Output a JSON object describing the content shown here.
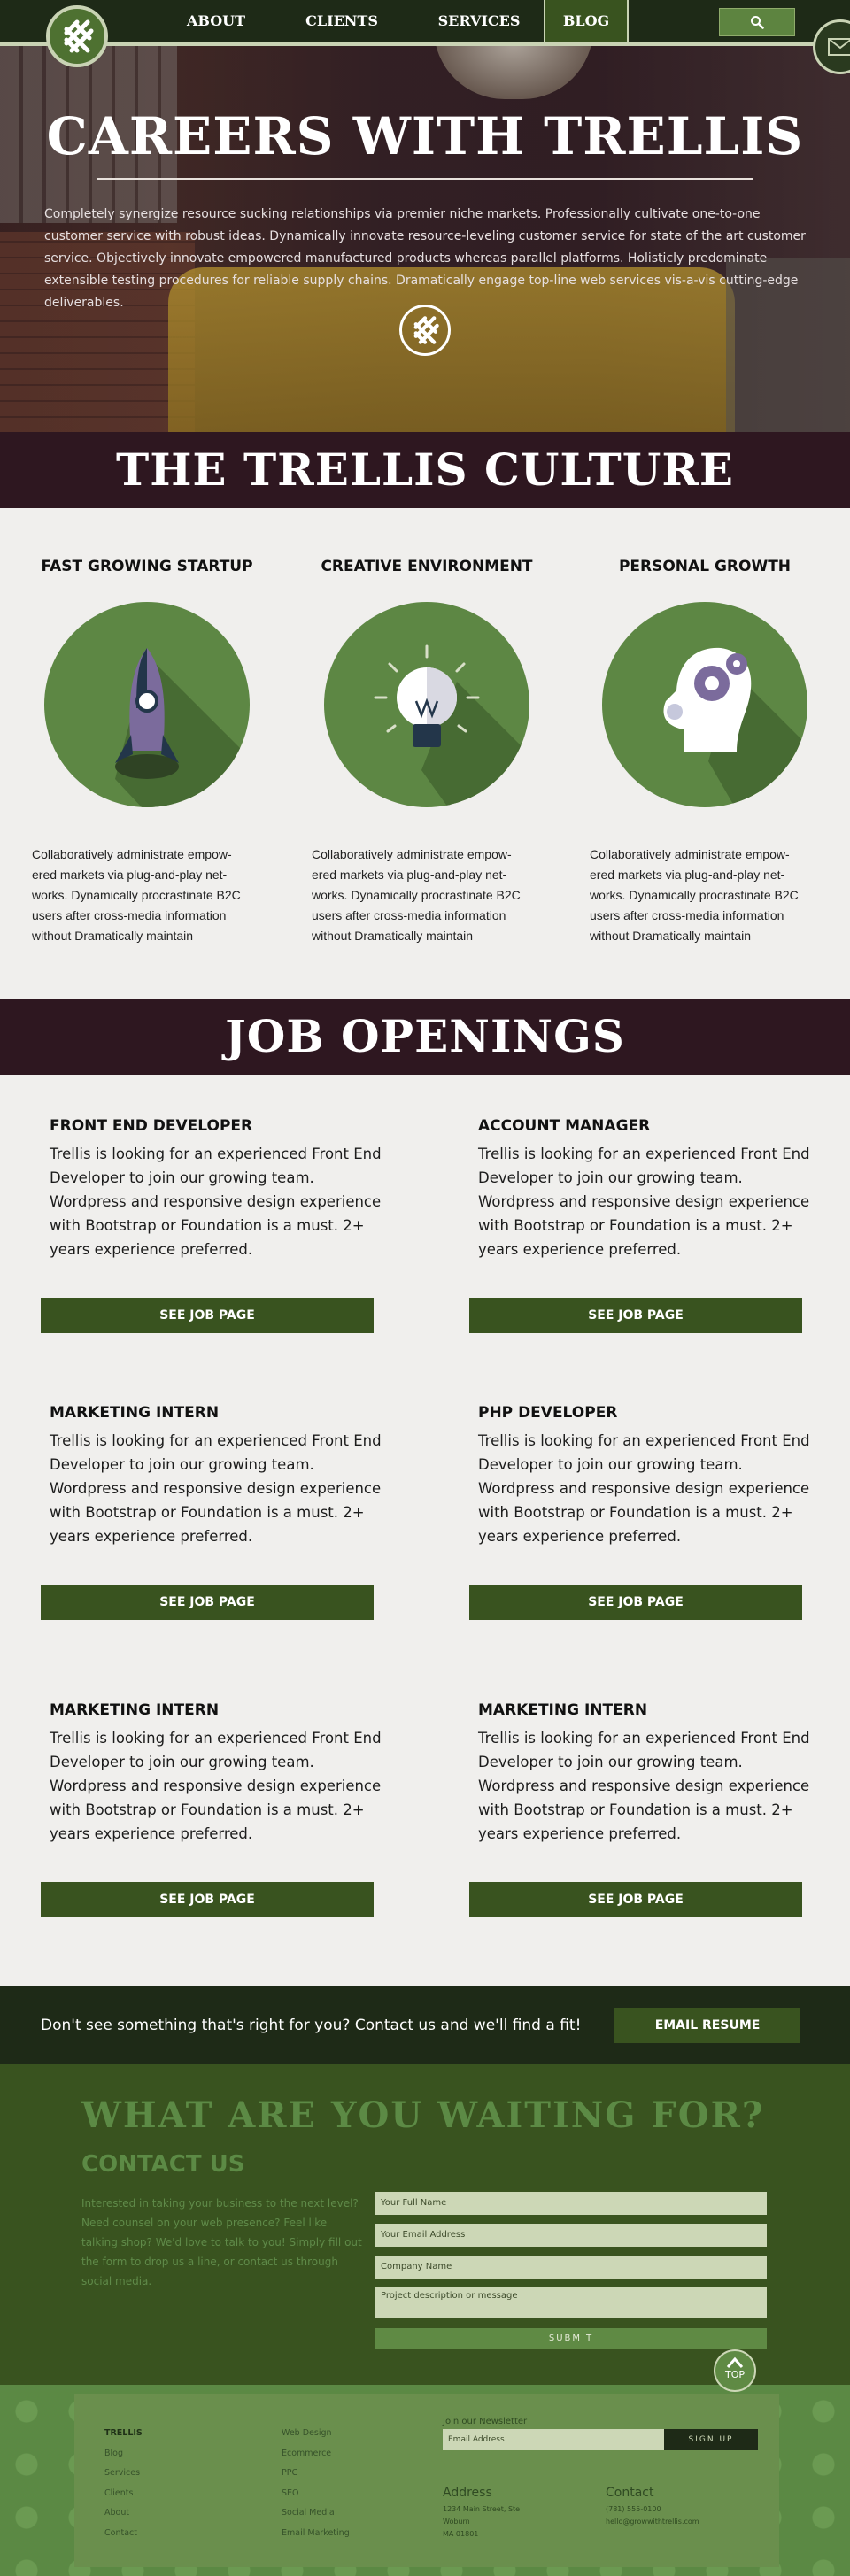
{
  "nav": {
    "links": [
      "ABOUT",
      "CLIENTS",
      "SERVICES",
      "BLOG"
    ],
    "active": "BLOG"
  },
  "hero": {
    "title": "CAREERS WITH TRELLIS",
    "text": "Completely synergize resource sucking relationships via premier niche markets. Professionally cultivate one-to-one customer service with robust ideas. Dynamically innovate resource-leveling customer service for state of the art customer service. Objectively innovate empowered manufactured products whereas parallel platforms. Holisticly predominate extensible testing procedures for reliable supply chains. Dramatically engage top-line web services vis-a-vis cutting-edge deliverables."
  },
  "culture": {
    "heading": "THE TRELLIS CULTURE",
    "items": [
      {
        "title": "FAST GROWING STARTUP",
        "icon": "rocket-icon",
        "text": "Collaboratively administrate empow-ered markets via plug-and-play net-works. Dynamically procrastinate B2C users after cross-media information without Dramatically maintain"
      },
      {
        "title": "CREATIVE ENVIRONMENT",
        "icon": "lightbulb-icon",
        "text": "Collaboratively administrate empow-ered markets via plug-and-play net-works. Dynamically procrastinate B2C users after cross-media information without Dramatically maintain"
      },
      {
        "title": "PERSONAL GROWTH",
        "icon": "head-gears-icon",
        "text": "Collaboratively administrate empow-ered markets via plug-and-play net-works. Dynamically procrastinate B2C users after cross-media information without Dramatically maintain"
      }
    ]
  },
  "jobs": {
    "heading": "JOB OPENINGS",
    "button_label": "SEE JOB PAGE",
    "items": [
      {
        "title": "FRONT END DEVELOPER",
        "description": "Trellis is looking for an experienced Front End Developer to join our growing team. Wordpress and responsive design experience with Bootstrap or Foundation is a must. 2+ years experience preferred."
      },
      {
        "title": "ACCOUNT MANAGER",
        "description": "Trellis is looking for an experienced Front End Developer to join our growing team. Wordpress and responsive design experience with Bootstrap or Foundation is a must. 2+ years experience preferred."
      },
      {
        "title": "MARKETING INTERN",
        "description": "Trellis is looking for an experienced Front End Developer to join our growing team. Wordpress and responsive design experience with Bootstrap or Foundation is a must. 2+ years experience preferred."
      },
      {
        "title": "PHP DEVELOPER",
        "description": "Trellis is looking for an experienced Front End Developer to join our growing team. Wordpress and responsive design experience with Bootstrap or Foundation is a must. 2+ years experience preferred."
      },
      {
        "title": "MARKETING INTERN",
        "description": "Trellis is looking for an experienced Front End Developer to join our growing team. Wordpress and responsive design experience with Bootstrap or Foundation is a must. 2+ years experience preferred."
      },
      {
        "title": "MARKETING INTERN",
        "description": "Trellis is looking for an experienced Front End Developer to join our growing team. Wordpress and responsive design experience with Bootstrap or Foundation is a must. 2+ years experience preferred."
      }
    ]
  },
  "cta": {
    "text": "Don't see something that's right for you? Contact us and we'll find a fit!",
    "button": "EMAIL RESUME"
  },
  "contact": {
    "headline": "WHAT ARE YOU WAITING FOR?",
    "subheading": "CONTACT US",
    "intro": "Interested in taking your business to the next level? Need counsel on your web presence? Feel like talking shop? We'd love to talk to you! Simply fill out the form to drop us a line, or contact us through social media.",
    "placeholders": {
      "name": "Your Full Name",
      "email": "Your Email Address",
      "company": "Company Name",
      "message": "Project description or message"
    },
    "submit": "SUBMIT",
    "top": "TOP"
  },
  "footer": {
    "col1": [
      "TRELLIS",
      "Blog",
      "Services",
      "Clients",
      "About",
      "Contact"
    ],
    "col2": [
      "Web Design",
      "Ecommerce",
      "PPC",
      "SEO",
      "Social Media",
      "Email Marketing"
    ],
    "newsletter_label": "Join our Newsletter",
    "newsletter_placeholder": "Email Address",
    "newsletter_button": "SIGN UP",
    "address_heading": "Address",
    "address_lines": [
      "1234 Main Street, Ste",
      "Woburn",
      "MA 01801"
    ],
    "contact_heading": "Contact",
    "contact_lines": [
      "(781) 555-0100",
      "hello@growwithtrellis.com"
    ]
  },
  "colors": {
    "dark_green": "#1e2a17",
    "green": "#39531f",
    "light_green": "#5d8744",
    "plum": "#2e1720",
    "pale": "#ccd7b6"
  }
}
